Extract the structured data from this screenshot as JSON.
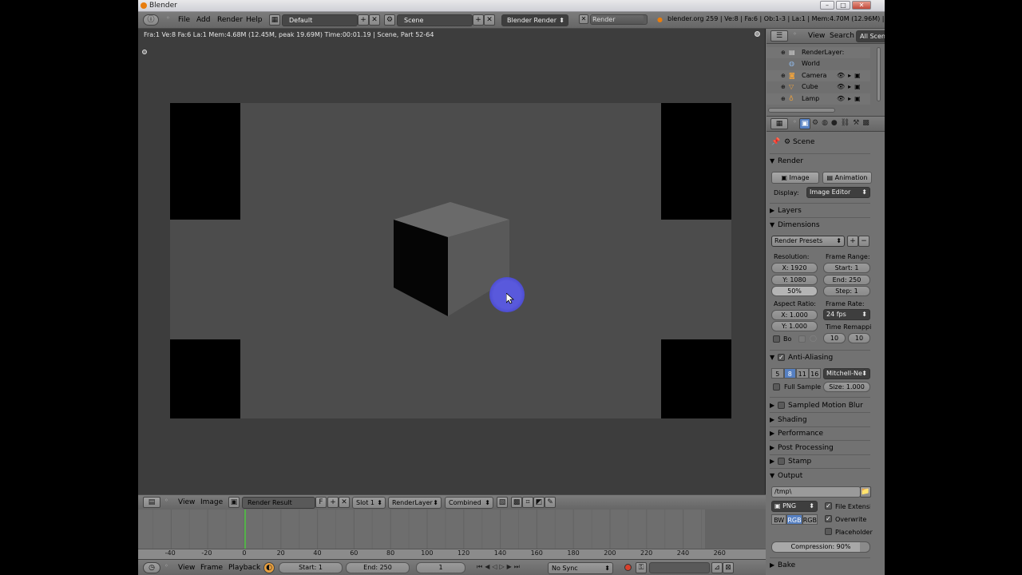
{
  "window": {
    "title": "Blender",
    "buttons": [
      "–",
      "□",
      "✕"
    ]
  },
  "info_header": {
    "menus": [
      "File",
      "Add",
      "Render",
      "Help"
    ],
    "screen_layout": "Default",
    "scene": "Scene",
    "engine": "Blender Render",
    "render_progress_label": "Render",
    "stats": "blender.org 259 | Ve:8 | Fa:6 | Ob:1-3 | La:1 | Mem:4.70M (12.96M) | Cam"
  },
  "viewport": {
    "render_stats": "Fra:1  Ve:8 Fa:6 La:1 Mem:4.68M (12.45M, peak 19.69M) Time:00:01.19 | Scene, Part 52-64"
  },
  "image_editor_header": {
    "menus": [
      "View",
      "Image"
    ],
    "image_name": "Render Result",
    "fake_user": "F",
    "slot": "Slot 1",
    "layer": "RenderLayer",
    "pass": "Combined"
  },
  "timeline": {
    "ticks": [
      "-40",
      "-20",
      "0",
      "20",
      "40",
      "60",
      "80",
      "100",
      "120",
      "140",
      "160",
      "180",
      "200",
      "220",
      "240",
      "260"
    ],
    "current_frame_marker": 0
  },
  "timeline_footer": {
    "menus": [
      "View",
      "Frame",
      "Playback"
    ],
    "start": "Start: 1",
    "end": "End: 250",
    "current": "1",
    "sync": "No Sync"
  },
  "outliner": {
    "header_menus": [
      "View",
      "Search"
    ],
    "filter": "All Scen",
    "items": [
      {
        "label": "RenderLayer:",
        "icon": "renderlayer-icon"
      },
      {
        "label": "World",
        "icon": "world-icon"
      },
      {
        "label": "Camera",
        "icon": "camera-icon"
      },
      {
        "label": "Cube",
        "icon": "mesh-icon"
      },
      {
        "label": "Lamp",
        "icon": "lamp-icon"
      }
    ]
  },
  "properties": {
    "context": "Scene",
    "render": {
      "title": "Render",
      "image_button": "Image",
      "animation_button": "Animation",
      "display_label": "Display:",
      "display_value": "Image Editor"
    },
    "layers_title": "Layers",
    "dimensions": {
      "title": "Dimensions",
      "presets": "Render Presets",
      "resolution_label": "Resolution:",
      "res_x": "X: 1920",
      "res_y": "Y: 1080",
      "res_pct": "50%",
      "frame_range_label": "Frame Range:",
      "start": "Start: 1",
      "end": "End: 250",
      "step": "Step: 1",
      "aspect_label": "Aspect Ratio:",
      "aspect_x": "X: 1.000",
      "aspect_y": "Y: 1.000",
      "frame_rate_label": "Frame Rate:",
      "frame_rate": "24 fps",
      "time_remap_label": "Time Remappi",
      "remap_old": "10",
      "remap_new": "10",
      "border_label": "Bo"
    },
    "anti_aliasing": {
      "title": "Anti-Aliasing",
      "samples": [
        "5",
        "8",
        "11",
        "16"
      ],
      "selected_sample": "8",
      "filter": "Mitchell-Ne",
      "full_sample": "Full Sample",
      "size": "Size: 1.000"
    },
    "collapsed_sections": [
      "Sampled Motion Blur",
      "Shading",
      "Performance",
      "Post Processing",
      "Stamp"
    ],
    "output": {
      "title": "Output",
      "path": "/tmp\\",
      "format": "PNG",
      "file_ext": "File Extensi",
      "overwrite": "Overwrite",
      "placeholders": "Placeholder",
      "color_modes": [
        "BW",
        "RGB",
        "RGB"
      ],
      "selected_color_mode": 1,
      "compression": "Compression: 90%"
    },
    "bake_title": "Bake"
  },
  "colors": {
    "viewport_bg": "#3d3d3d",
    "render_bg": "#4c4c4c",
    "panel_bg": "#727272",
    "accent_blue": "#5680c2",
    "cursor_halo": "#4a4ae0"
  }
}
